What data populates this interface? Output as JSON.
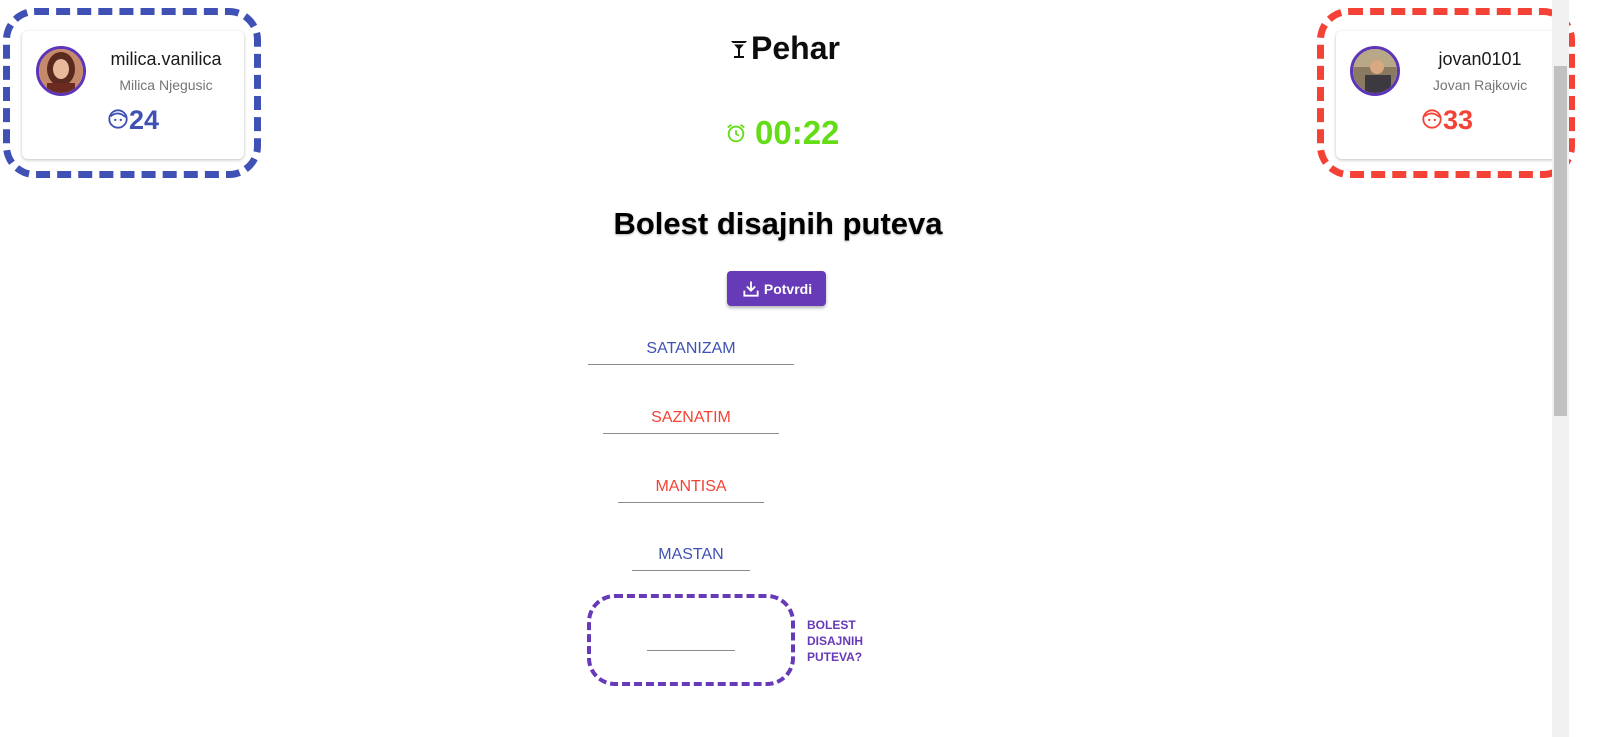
{
  "players": {
    "left": {
      "username": "milica.vanilica",
      "full_name": "Milica Njegusic",
      "score": "24",
      "color": "#3f51b5",
      "icon": "face-icon"
    },
    "right": {
      "username": "jovan0101",
      "full_name": "Jovan Rajkovic",
      "score": "33",
      "color": "#f44336",
      "icon": "face-icon"
    }
  },
  "header": {
    "title": "Pehar",
    "title_icon": "cocktail-glass-icon",
    "timer": "00:22",
    "timer_icon": "alarm-clock-icon",
    "timer_color": "#64dd17"
  },
  "question": "Bolest disajnih puteva",
  "confirm_button": {
    "label": "Potvrdi",
    "icon": "download-icon",
    "color": "#673ab7"
  },
  "answers": [
    {
      "text": "SATANIZAM",
      "owner": "left"
    },
    {
      "text": "SAZNATIM",
      "owner": "right"
    },
    {
      "text": "MANTISA",
      "owner": "right"
    },
    {
      "text": "MASTAN",
      "owner": "left"
    }
  ],
  "final_answer": {
    "value": "",
    "hint": "Bolest disajnih puteva?"
  }
}
